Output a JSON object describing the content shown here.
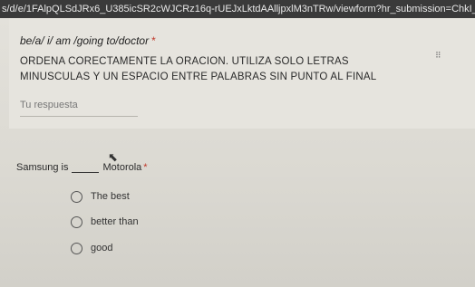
{
  "browser": {
    "url": "s/d/e/1FAlpQLSdJRx6_U385icSR2cWJCRz16q-rUEJxLktdAAlljpxlM3nTRw/viewform?hr_submission=ChkI_oqCms0OEIW"
  },
  "question1": {
    "title": "be/a/ i/ am /going to/doctor",
    "required_mark": "*",
    "description": "ORDENA CORECTAMENTE LA ORACION. UTILIZA SOLO LETRAS MINUSCULAS Y UN ESPACIO ENTRE PALABRAS SIN PUNTO AL FINAL",
    "answer_placeholder": "Tu respuesta",
    "drag_icon": "drag-handle-icon"
  },
  "question2": {
    "text_before": "Samsung is",
    "text_after": "Motorola",
    "required_mark": "*",
    "options": [
      {
        "label": "The best",
        "selected": false
      },
      {
        "label": "better than",
        "selected": false
      },
      {
        "label": "good",
        "selected": false
      }
    ]
  },
  "colors": {
    "required": "#c0392b",
    "background": "#e4e2dc"
  }
}
